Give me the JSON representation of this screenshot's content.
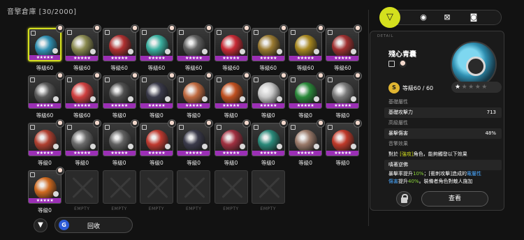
{
  "header": {
    "title": "音擎倉庫 [30/2000]"
  },
  "stars_string": "★★★★★",
  "cards": [
    {
      "level": "等級60",
      "color": "#2f8fb1",
      "selected": true
    },
    {
      "level": "等級60",
      "color": "#8a8a50"
    },
    {
      "level": "等級60",
      "color": "#b03030"
    },
    {
      "level": "等級60",
      "color": "#3ab0a0"
    },
    {
      "level": "等級60",
      "color": "#606060"
    },
    {
      "level": "等級60",
      "color": "#c82a35"
    },
    {
      "level": "等級60",
      "color": "#9a7a30"
    },
    {
      "level": "等級60",
      "color": "#a88820"
    },
    {
      "level": "等級60",
      "color": "#a03030"
    },
    {
      "level": "等級60",
      "color": "#5a5a5a"
    },
    {
      "level": "等級60",
      "color": "#d04040"
    },
    {
      "level": "等級0",
      "color": "#505050"
    },
    {
      "level": "等級0",
      "color": "#3a3a4a"
    },
    {
      "level": "等級0",
      "color": "#c06a40"
    },
    {
      "level": "等級0",
      "color": "#c05020"
    },
    {
      "level": "等級0",
      "color": "#c8c8c8"
    },
    {
      "level": "等級0",
      "color": "#2a8a3a"
    },
    {
      "level": "等級0",
      "color": "#7a7a7a"
    },
    {
      "level": "等級0",
      "color": "#b04030"
    },
    {
      "level": "等級0",
      "color": "#6a6a6a"
    },
    {
      "level": "等級0",
      "color": "#606060"
    },
    {
      "level": "等級0",
      "color": "#c03a30"
    },
    {
      "level": "等級0",
      "color": "#3a3a4a"
    },
    {
      "level": "等級0",
      "color": "#a03040"
    },
    {
      "level": "等級0",
      "color": "#2a8a7a"
    },
    {
      "level": "等級0",
      "color": "#9a7a6a"
    },
    {
      "level": "等級0",
      "color": "#c03a2a"
    },
    {
      "level": "等級0",
      "color": "#d06a20"
    }
  ],
  "empty_label": "EMPTY",
  "empty_count": 6,
  "bottom": {
    "filter_icon": "funnel-icon",
    "recycle_icon_letter": "G",
    "recycle_label": "回收"
  },
  "tabs": [
    {
      "name": "w-engine-tab",
      "glyph": "▽"
    },
    {
      "name": "disc-tab",
      "glyph": "◉"
    },
    {
      "name": "x-box-tab",
      "glyph": "⊠"
    },
    {
      "name": "drive-tab",
      "glyph": "◙"
    }
  ],
  "detail": {
    "section_tag": "DETAIL",
    "name": "殘心青囊",
    "level_badge": "S",
    "level_text": "等級60 / 60",
    "stars_on": "★",
    "stars_off": "★★★★",
    "base_head": "基礎屬性",
    "base_stat_name": "基礎攻擊力",
    "base_stat_val": "713",
    "adv_head": "高級屬性",
    "adv_stat_name": "暴擊傷害",
    "adv_stat_val": "48%",
    "effect_head": "音擎效果",
    "effect_prefix": "對於",
    "effect_tag": "[強攻]",
    "effect_suffix": "角色，能夠觸發以下效果",
    "skill_title": "嗔著逆佛",
    "skill_line1_a": "暴擊率提升",
    "skill_line1_g": "10%",
    "skill_line1_b": "；[衝刺攻擊]造成的",
    "skill_line1_blue": "電屬性",
    "skill_line2_blue": "傷害",
    "skill_line2_a": "提升",
    "skill_line2_g": "40%",
    "skill_line2_b": "。裝備者角色對敵人施加",
    "view_label": "查看"
  }
}
